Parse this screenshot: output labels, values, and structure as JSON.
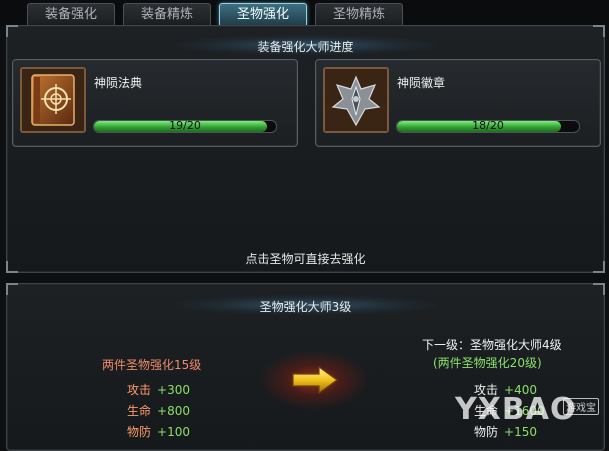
{
  "tabs": [
    {
      "label": "装备强化",
      "active": false
    },
    {
      "label": "装备精炼",
      "active": false
    },
    {
      "label": "圣物强化",
      "active": true
    },
    {
      "label": "圣物精炼",
      "active": false
    }
  ],
  "master_progress": {
    "title": "装备强化大师进度",
    "items": [
      {
        "name": "神陨法典",
        "progress_text": "19/20",
        "progress": 0.95,
        "icon": "tome-icon"
      },
      {
        "name": "神陨徽章",
        "progress_text": "18/20",
        "progress": 0.9,
        "icon": "emblem-icon"
      }
    ],
    "hint": "点击圣物可直接去强化"
  },
  "master_level": {
    "title": "圣物强化大师3级",
    "current": {
      "condition": "两件圣物强化15级",
      "stats": [
        {
          "name": "攻击",
          "value": "+300"
        },
        {
          "name": "生命",
          "value": "+800"
        },
        {
          "name": "物防",
          "value": "+100"
        }
      ]
    },
    "next": {
      "title": "下一级：圣物强化大师4级",
      "condition": "(两件圣物强化20级)",
      "stats": [
        {
          "name": "攻击",
          "value": "+400"
        },
        {
          "name": "生命",
          "value": "+1600"
        },
        {
          "name": "物防",
          "value": "+150"
        }
      ]
    },
    "arrow_icon": "arrow-right-icon"
  },
  "watermark": {
    "text": "YXBAO",
    "badge": "游戏宝"
  },
  "colors": {
    "accent": "#8fd3e6",
    "progress": "#2e9a2e",
    "stat_value": "#8be06a",
    "current_condition": "#f08a6a"
  }
}
